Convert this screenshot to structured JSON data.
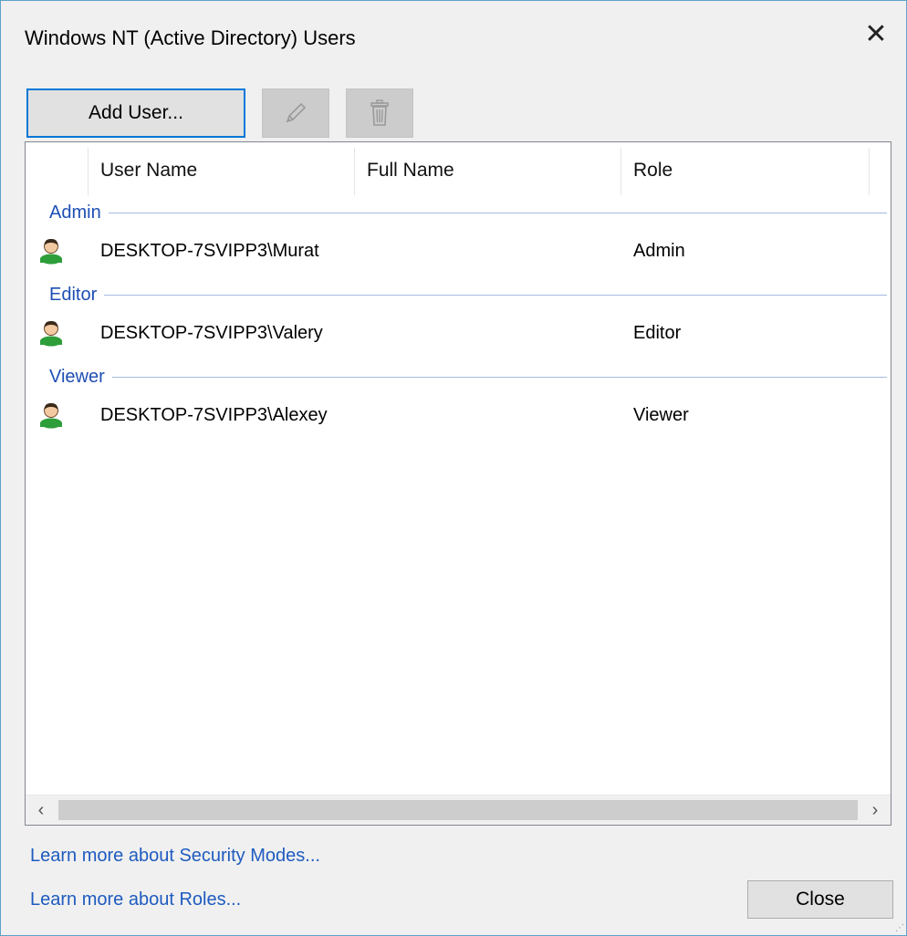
{
  "window": {
    "title": "Windows NT (Active Directory) Users",
    "close_glyph": "✕"
  },
  "toolbar": {
    "add_user_label": "Add User...",
    "edit_icon": "pencil-icon",
    "delete_icon": "trash-icon"
  },
  "list": {
    "columns": [
      {
        "label": "User Name"
      },
      {
        "label": "Full Name"
      },
      {
        "label": "Role"
      }
    ],
    "groups": [
      {
        "label": "Admin",
        "rows": [
          {
            "user_name": "DESKTOP-7SVIPP3\\Murat",
            "full_name": "",
            "role": "Admin",
            "icon": "user-icon"
          }
        ]
      },
      {
        "label": "Editor",
        "rows": [
          {
            "user_name": "DESKTOP-7SVIPP3\\Valery",
            "full_name": "",
            "role": "Editor",
            "icon": "user-icon"
          }
        ]
      },
      {
        "label": "Viewer",
        "rows": [
          {
            "user_name": "DESKTOP-7SVIPP3\\Alexey",
            "full_name": "",
            "role": "Viewer",
            "icon": "user-icon"
          }
        ]
      }
    ],
    "scroll_left": "‹",
    "scroll_right": "›"
  },
  "footer": {
    "link_security_modes": "Learn more about Security Modes...",
    "link_roles": "Learn more about Roles...",
    "close_label": "Close"
  },
  "colors": {
    "accent": "#0078d7",
    "group_label": "#1e4fb5",
    "link": "#1e5bbf",
    "window_border": "#5ba3c9"
  }
}
